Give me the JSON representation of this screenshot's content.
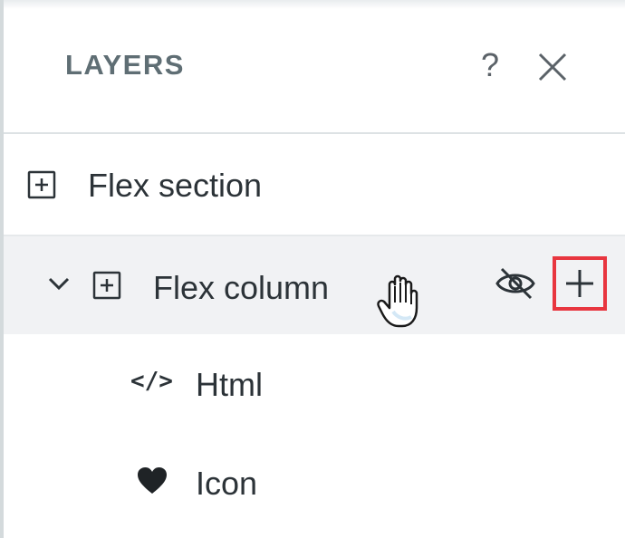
{
  "header": {
    "title": "LAYERS",
    "help_glyph": "?",
    "close_icon": "close-icon"
  },
  "layers": [
    {
      "label": "Flex section",
      "icon": "add-square-icon",
      "depth": 0,
      "expanded": null,
      "hovered": false
    },
    {
      "label": "Flex column",
      "icon": "add-square-icon",
      "depth": 1,
      "expanded": true,
      "hovered": true
    },
    {
      "label": "Html",
      "icon": "code-icon",
      "icon_glyph": "</>",
      "depth": 2,
      "expanded": null,
      "hovered": false
    },
    {
      "label": "Icon",
      "icon": "heart-icon",
      "depth": 2,
      "expanded": null,
      "hovered": false
    }
  ],
  "row_actions": {
    "visibility_icon": "eye-off-icon",
    "add_icon": "plus-icon",
    "add_highlight_color": "#e8363f"
  },
  "colors": {
    "title": "#5f6e74",
    "text": "#2c3338",
    "hover_row": "#f1f2f4",
    "divider": "#dde2e4"
  }
}
